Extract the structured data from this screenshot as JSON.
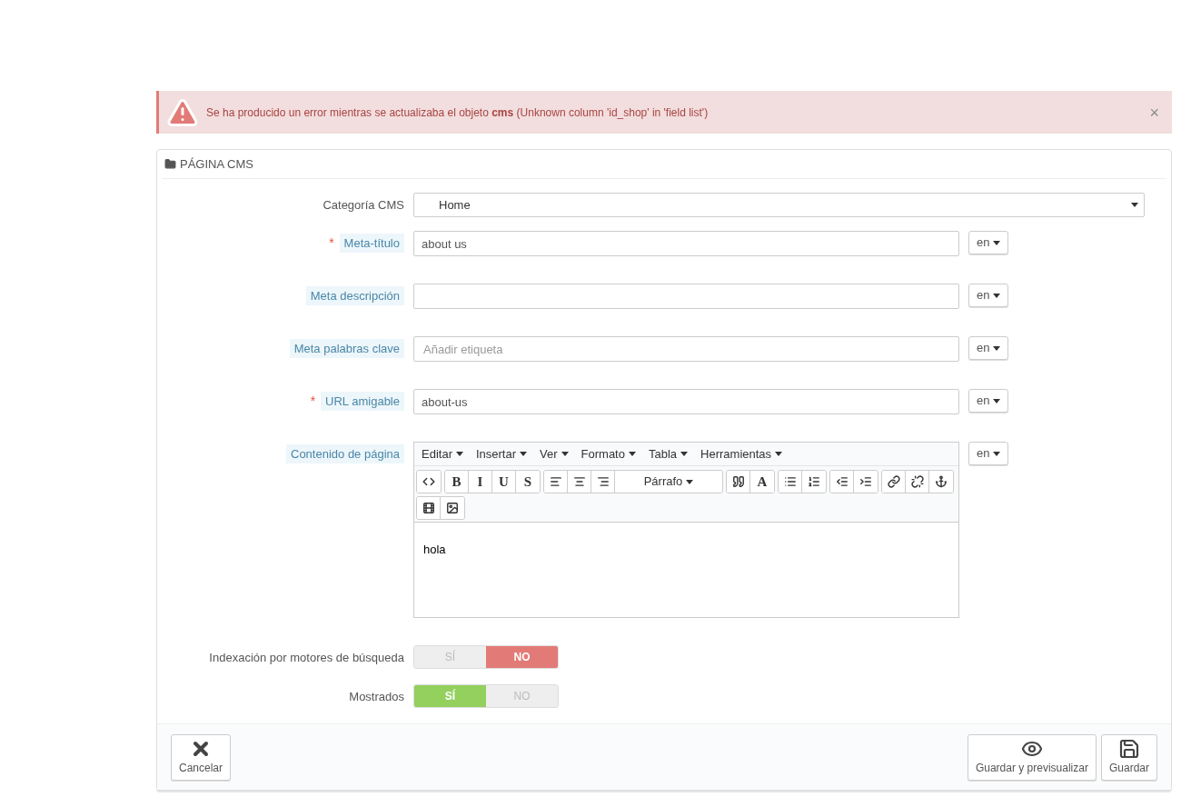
{
  "alert": {
    "text": "Se ha producido un error mientras se actualizaba el objeto **cms** (Unknown column 'id_shop' in 'field list')",
    "close": "×"
  },
  "panel": {
    "title": "PÁGINA CMS"
  },
  "fields": [
    {
      "kind": "select",
      "label": "Categoría CMS",
      "hint": false,
      "value": "Home"
    },
    {
      "kind": "text",
      "label": "Meta-título",
      "required_mark": "*",
      "hint": true,
      "value": "about us",
      "lang": "en"
    },
    {
      "kind": "text",
      "label": "Meta descripción",
      "hint": true,
      "lang": "en"
    },
    {
      "kind": "text",
      "label": "Meta palabras clave",
      "hint": true,
      "placeholder": "Añadir etiqueta",
      "lang": "en"
    },
    {
      "kind": "text",
      "label": "URL amigable",
      "required_mark": "*",
      "hint": true,
      "value": "about-us",
      "lang": "en"
    },
    {
      "kind": "editor",
      "label": "Contenido de página",
      "hint": true,
      "lang": "en",
      "menu": [
        "Editar",
        "Insertar",
        "Ver",
        "Formato",
        "Tabla",
        "Herramientas"
      ],
      "toolbar": [
        [
          [
            {
              "kind": "code"
            }
          ],
          [
            {
              "kind": "letter",
              "label": "B"
            },
            {
              "kind": "letter",
              "label": "I"
            },
            {
              "kind": "letter",
              "label": "U"
            },
            {
              "kind": "letter",
              "label": "S"
            }
          ],
          [
            {
              "kind": "alignleft"
            },
            {
              "kind": "aligncenter"
            },
            {
              "kind": "alignright"
            },
            {
              "kind": "dropdown",
              "label": "Párrafo"
            }
          ],
          [
            {
              "kind": "quote"
            },
            {
              "kind": "letter",
              "label": "A"
            }
          ],
          [
            {
              "kind": "bullist"
            },
            {
              "kind": "numlist"
            }
          ],
          [
            {
              "kind": "outdent"
            },
            {
              "kind": "indent"
            }
          ],
          [
            {
              "kind": "link"
            },
            {
              "kind": "unlink"
            },
            {
              "kind": "anchor"
            }
          ]
        ],
        [
          [
            {
              "kind": "film"
            },
            {
              "kind": "image"
            }
          ]
        ]
      ],
      "content": "hola"
    },
    {
      "kind": "switch",
      "label": "Indexación por motores de búsqueda",
      "hint": false,
      "options": [
        {
          "label": "SÍ",
          "selected": false
        },
        {
          "label": "NO",
          "selected": true
        }
      ]
    },
    {
      "kind": "switch",
      "label": "Mostrados",
      "hint": false,
      "options": [
        {
          "label": "SÍ",
          "selected": true
        },
        {
          "label": "NO",
          "selected": false
        }
      ]
    }
  ],
  "footer": {
    "left": [
      {
        "label": "Cancelar",
        "kind": "cancel"
      }
    ],
    "right": [
      {
        "label": "Guardar y previsualizar",
        "kind": "preview"
      },
      {
        "label": "Guardar",
        "kind": "save"
      }
    ]
  }
}
